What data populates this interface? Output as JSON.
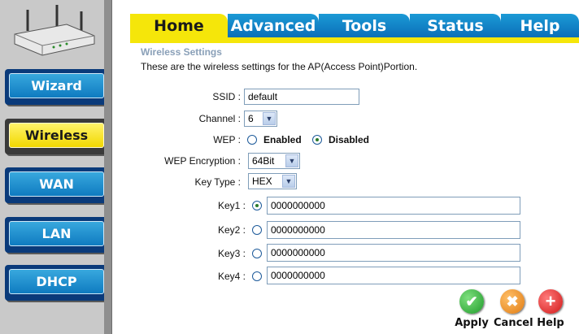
{
  "tabs": [
    "Home",
    "Advanced",
    "Tools",
    "Status",
    "Help"
  ],
  "sidebar": [
    {
      "label": "Wizard"
    },
    {
      "label": "Wireless"
    },
    {
      "label": "WAN"
    },
    {
      "label": "LAN"
    },
    {
      "label": "DHCP"
    }
  ],
  "section": {
    "title": "Wireless Settings",
    "description": "These are the wireless settings for the AP(Access Point)Portion."
  },
  "form": {
    "ssid_label": "SSID :",
    "ssid_value": "default",
    "channel_label": "Channel :",
    "channel_value": "6",
    "wep_label": "WEP :",
    "wep_enabled": "Enabled",
    "wep_disabled": "Disabled",
    "wep_encryption_label": "WEP Encryption :",
    "wep_encryption_value": "64Bit",
    "key_type_label": "Key Type :",
    "key_type_value": "HEX",
    "keys": [
      {
        "label": "Key1 :",
        "value": "0000000000"
      },
      {
        "label": "Key2 :",
        "value": "0000000000"
      },
      {
        "label": "Key3 :",
        "value": "0000000000"
      },
      {
        "label": "Key4 :",
        "value": "0000000000"
      }
    ]
  },
  "actions": {
    "apply": "Apply",
    "cancel": "Cancel",
    "help": "Help"
  }
}
